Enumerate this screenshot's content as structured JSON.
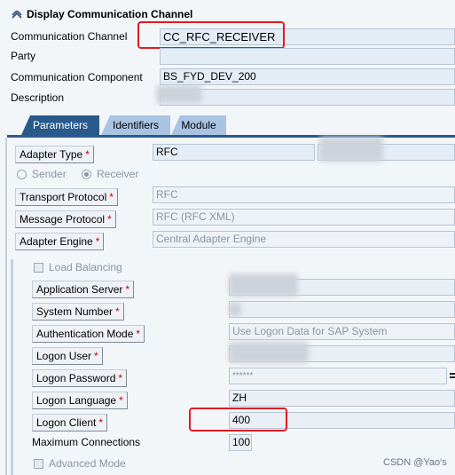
{
  "window": {
    "title": "Display Communication Channel"
  },
  "header_fields": {
    "channel_label": "Communication Channel",
    "channel_value": "CC_RFC_RECEIVER",
    "party_label": "Party",
    "party_value": "",
    "component_label": "Communication Component",
    "component_value": "BS_FYD_DEV_200",
    "description_label": "Description"
  },
  "tabs": [
    {
      "label": "Parameters",
      "active": true
    },
    {
      "label": "Identifiers",
      "active": false
    },
    {
      "label": "Module",
      "active": false
    }
  ],
  "params": {
    "adapter_type_label": "Adapter Type",
    "adapter_type_value": "RFC",
    "sender_label": "Sender",
    "receiver_label": "Receiver",
    "transport_protocol_label": "Transport Protocol",
    "transport_protocol_value": "RFC",
    "message_protocol_label": "Message Protocol",
    "message_protocol_value": "RFC (RFC XML)",
    "adapter_engine_label": "Adapter Engine",
    "adapter_engine_value": "Central Adapter Engine",
    "load_balancing_label": "Load Balancing",
    "app_server_label": "Application Server",
    "system_number_label": "System Number",
    "auth_mode_label": "Authentication Mode",
    "auth_mode_value": "Use Logon Data for SAP System",
    "logon_user_label": "Logon User",
    "logon_password_label": "Logon Password",
    "logon_password_value": "******",
    "logon_language_label": "Logon Language",
    "logon_language_value": "ZH",
    "logon_client_label": "Logon Client",
    "logon_client_value": "400",
    "max_conn_label": "Maximum Connections",
    "max_conn_value": "100",
    "advanced_mode_label": "Advanced Mode",
    "required_marker": "*"
  },
  "watermark": "CSDN @Yao's",
  "colors": {
    "tab_active": "#2a5a8c",
    "tab_inactive": "#a9c4e2",
    "field_bg": "#e4edf6",
    "highlight_red": "#e11b22"
  }
}
